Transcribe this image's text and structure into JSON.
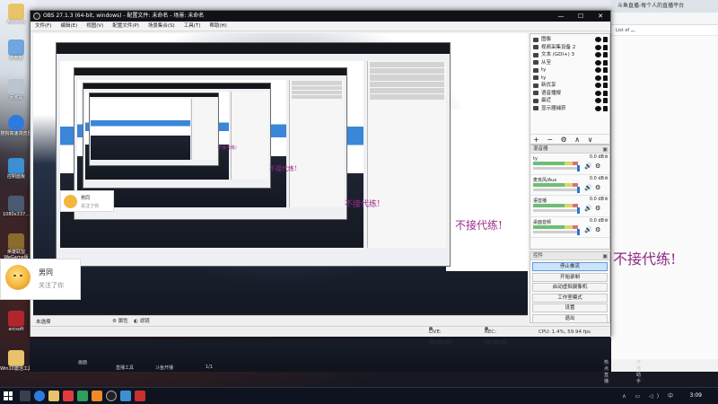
{
  "desktop": {
    "icons": [
      {
        "label": "Adminis",
        "theme": "dark"
      },
      {
        "label": "此电脑",
        "theme": "dark"
      },
      {
        "label": "回收站",
        "theme": "dark"
      },
      {
        "label": "搜狗高速浏览器",
        "theme": "dark"
      },
      {
        "label": "控制面板",
        "theme": "dark"
      },
      {
        "label": "1080x337...",
        "theme": "dark"
      },
      {
        "label": "英雄联盟WeGame版",
        "theme": "dark"
      },
      {
        "label": "arcsoft",
        "theme": "dark"
      },
      {
        "label": "Win10激活工具",
        "theme": "dark"
      }
    ]
  },
  "browser": {
    "tab_title": "斗鱼直播-每个人的直播平台",
    "bookmark": "List of 灬",
    "left_tab": "斗鱼直播-每个人的直播平台"
  },
  "obs": {
    "title": "OBS 27.1.3 (64-bit, windows) - 配置文件: 未命名 - 场景: 未命名",
    "menu": [
      "文件(F)",
      "编辑(E)",
      "视图(V)",
      "配置文件(P)",
      "场景集合(S)",
      "工具(T)",
      "帮助(H)"
    ],
    "win_buttons": [
      "—",
      "☐",
      "✕"
    ],
    "preview_text": "不接代练!",
    "nested_text": [
      "不接代练!",
      "不接代练!",
      "不接代练!"
    ],
    "status": {
      "live": "LIVE: 00:00:00",
      "rec": "REC: 00:00:00",
      "cpu": "CPU: 1.4%, 59.94 fps"
    },
    "chat_label": "未选择",
    "chat_props": "属性",
    "chat_filters": "滤镜",
    "sources_header": "来源",
    "sources": [
      {
        "name": "图像"
      },
      {
        "name": "视频采集设备 2"
      },
      {
        "name": "文本 (GDI+) 3"
      },
      {
        "name": "从至"
      },
      {
        "name": "ty"
      },
      {
        "name": "ty"
      },
      {
        "name": "新优享"
      },
      {
        "name": "语音播报"
      },
      {
        "name": "最近"
      },
      {
        "name": "显示器捕获"
      }
    ],
    "source_toolbar": "+ − ⚙ ∧ ∨",
    "mixer_header": "混音器",
    "mixer": [
      {
        "name": "ty",
        "db": "0.0 dB",
        "level": 0.9
      },
      {
        "name": "麦克风/Aux",
        "db": "0.0 dB",
        "level": 0.9
      },
      {
        "name": "语音播",
        "db": "0.0 dB",
        "level": 0.9
      },
      {
        "name": "桌面音频",
        "db": "0.0 dB",
        "level": 0.9
      }
    ],
    "controls_header": "控件",
    "controls": [
      {
        "label": "停止推流",
        "active": true
      },
      {
        "label": "开始录制",
        "active": false
      },
      {
        "label": "启动虚拟摄像机",
        "active": false
      },
      {
        "label": "工作室模式",
        "active": false
      },
      {
        "label": "设置",
        "active": false
      },
      {
        "label": "退出",
        "active": false
      }
    ]
  },
  "overlay_text": "不接代练!",
  "notification": {
    "name": "男同",
    "action": "关注了你",
    "stack_name": "男同",
    "stack_action": "关注了你"
  },
  "strip": {
    "items": [
      "画面",
      "直播工具",
      "斗鱼开播",
      "1/1",
      "热点直播",
      "开播助手"
    ]
  },
  "taskbar": {
    "time": "3:09",
    "tray": "∧ ▭ ◁) 中"
  },
  "colors": {
    "obs_title_bg": "#101216",
    "accent": "#2b73d6",
    "overlay_text": "#8e2a86"
  }
}
